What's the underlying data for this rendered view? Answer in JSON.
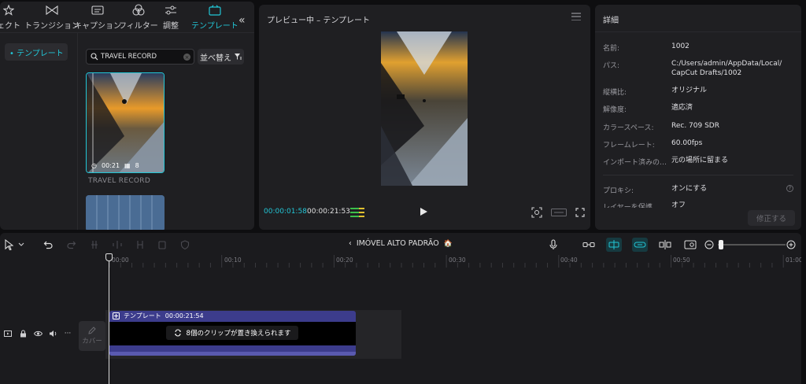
{
  "left_panel": {
    "tabs": [
      {
        "label": "ェクト",
        "icon": "effects-star-icon"
      },
      {
        "label": "トランジション",
        "icon": "transition-icon"
      },
      {
        "label": "キャプション",
        "icon": "caption-icon"
      },
      {
        "label": "フィルター",
        "icon": "filter-icon"
      },
      {
        "label": "調整",
        "icon": "adjust-sliders-icon"
      },
      {
        "label": "テンプレート",
        "icon": "template-icon",
        "active": true
      }
    ],
    "collapse_glyph": "«",
    "sidebar_item": "• テンプレート",
    "search": {
      "value": "TRAVEL RECORD",
      "clear_glyph": "×"
    },
    "sort_label": "並べ替え",
    "template_card": {
      "duration": "00:21",
      "clips": "8",
      "title": "TRAVEL RECORD"
    }
  },
  "preview": {
    "title": "プレビュー中 – テンプレート",
    "current_time": "00:00:01:58",
    "total_time": "00:00:21:53"
  },
  "details": {
    "title": "詳細",
    "rows": [
      {
        "label": "名前:",
        "value": "1002"
      },
      {
        "label": "パス:",
        "value": "C:/Users/admin/AppData/Local/ CapCut Drafts/1002"
      },
      {
        "label": "縦横比:",
        "value": "オリジナル"
      },
      {
        "label": "解像度:",
        "value": "適応済"
      },
      {
        "label": "カラースペース:",
        "value": "Rec. 709 SDR"
      },
      {
        "label": "フレームレート:",
        "value": "60.00fps"
      },
      {
        "label": "インポート済みの…",
        "value": "元の場所に留まる"
      }
    ],
    "proxy": {
      "label": "プロキシ:",
      "value": "オンにする"
    },
    "layer": {
      "label": "レイヤーを保護",
      "value": "オフ"
    },
    "modify_button": "修正する"
  },
  "timeline": {
    "project_name": "IMÓVEL ALTO PADRÃO",
    "project_emoji": "🏠",
    "ruler_labels": [
      "00:00",
      "00:10",
      "00:20",
      "00:30",
      "00:40",
      "00:50",
      "01:00"
    ],
    "cover_label": "カバー",
    "clip": {
      "label": "テンプレート",
      "duration": "00:00:21:54",
      "replace_text": "8個のクリップが置き換えられます"
    }
  },
  "colors": {
    "accent": "#22c6d6",
    "clip": "#3c3c8c"
  }
}
